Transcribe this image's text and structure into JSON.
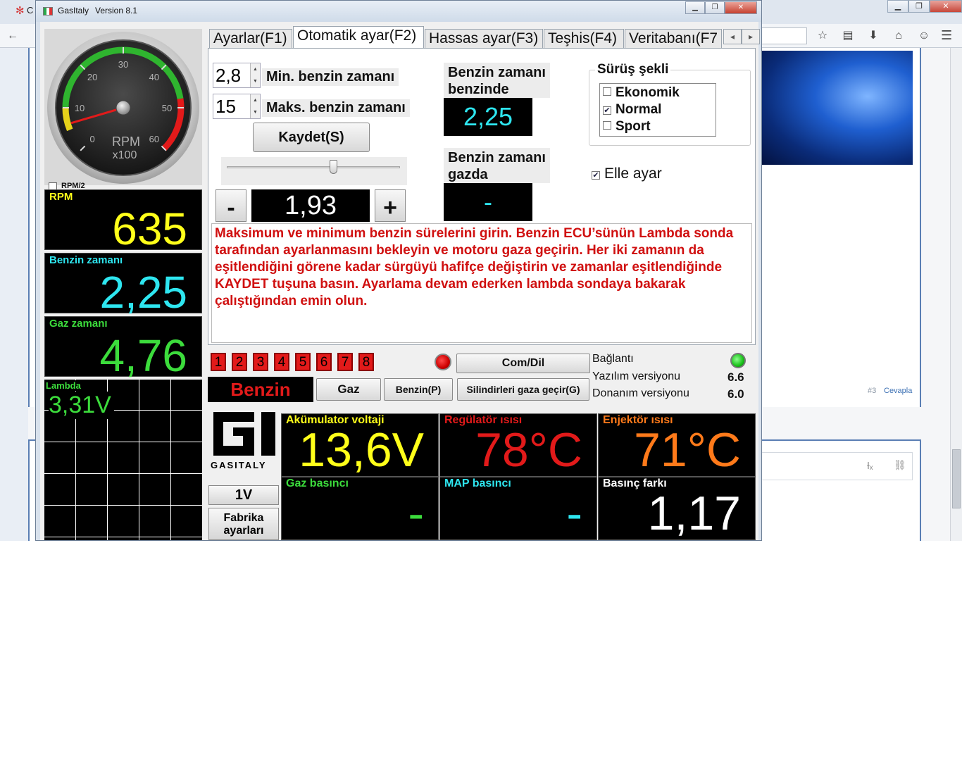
{
  "browser": {
    "tab_title_cut": "C",
    "page": {
      "reply_number": "#3",
      "reply_link": "Cevapla"
    }
  },
  "app": {
    "title": "GasItaly",
    "version": "Version 8.1",
    "gauge": {
      "unit_line1": "RPM",
      "unit_line2": "x100",
      "ticks": [
        "0",
        "10",
        "20",
        "30",
        "40",
        "50",
        "60"
      ],
      "needle_value": 6.35,
      "rpm_half_label": "RPM/2"
    },
    "readouts": {
      "rpm_label": "RPM",
      "rpm_value": "635",
      "petrol_time_label": "Benzin zamanı",
      "petrol_time_value": "2,25",
      "gas_time_label": "Gaz zamanı",
      "gas_time_value": "4,76",
      "lambda_label": "Lambda",
      "lambda_value": "3,31V"
    },
    "tabs": [
      {
        "label": "Ayarlar(F1)"
      },
      {
        "label": "Otomatik ayar(F2)"
      },
      {
        "label": "Hassas ayar(F3)"
      },
      {
        "label": "Teşhis(F4)"
      },
      {
        "label": "Veritabanı(F7"
      }
    ],
    "auto_tune": {
      "min_value": "2,8",
      "min_label": "Min. benzin zamanı",
      "max_value": "15",
      "max_label": "Maks. benzin zamanı",
      "save_label": "Kaydet(S)",
      "slider_position_pct": 62,
      "minus_label": "-",
      "plus_label": "+",
      "current_value": "1,93",
      "petrol_in_petrol_label_1": "Benzin zamanı",
      "petrol_in_petrol_label_2": "benzinde",
      "petrol_in_petrol_value": "2,25",
      "petrol_in_gas_label_1": "Benzin zamanı",
      "petrol_in_gas_label_2": "gazda",
      "petrol_in_gas_value": "-",
      "driving_mode_title": "Sürüş şekli",
      "driving_modes": [
        {
          "label": "Ekonomik",
          "checked": false
        },
        {
          "label": "Normal",
          "checked": true
        },
        {
          "label": "Sport",
          "checked": false
        }
      ],
      "manual_label": "Elle ayar",
      "manual_checked": true,
      "instruction": "Maksimum ve minimum benzin sürelerini girin. Benzin ECU’sünün Lambda sonda tarafından ayarlanmasını bekleyin ve motoru gaza geçirin. Her iki zamanın da eşitlendiğini görene kadar sürgüyü  hafifçe değiştirin ve zamanlar eşitlendiğinde KAYDET tuşuna basın. Ayarlama devam ederken lambda sondaya bakarak çalıştığından emin olun."
    },
    "cylinders": [
      "1",
      "2",
      "3",
      "4",
      "5",
      "6",
      "7",
      "8"
    ],
    "buttons": {
      "com_lang": "Com/Dil",
      "gas": "Gaz",
      "petrol_p": "Benzin(P)",
      "switch_cylinders": "Silindirleri gaza geçir(G)",
      "one_v": "1V",
      "factory_1": "Fabrika",
      "factory_2": "ayarları"
    },
    "fuel_mode": "Benzin",
    "info": {
      "connection_label": "Bağlantı",
      "software_label": "Yazılım versiyonu",
      "software_value": "6.6",
      "hardware_label": "Donanım versiyonu",
      "hardware_value": "6.0"
    },
    "logo_text": "GASITALY",
    "tiles": {
      "battery_label": "Akümulator voltaji",
      "battery_value": "13,6V",
      "regulator_label": "Regülatör ısısı",
      "regulator_value": "78°C",
      "injector_label": "Enjektör ısısı",
      "injector_value": "71°C",
      "gas_pressure_label": "Gaz basıncı",
      "gas_pressure_value": "-",
      "map_label": "MAP basıncı",
      "map_value": "-",
      "pressure_diff_label": "Basınç farkı",
      "pressure_diff_value": "1,17"
    },
    "colors": {
      "yellow": "#ffff1a",
      "cyan": "#2ee6f0",
      "green": "#3cdc3c",
      "red": "#e21a1a",
      "orange": "#ff7a1a",
      "white": "#ffffff"
    }
  }
}
